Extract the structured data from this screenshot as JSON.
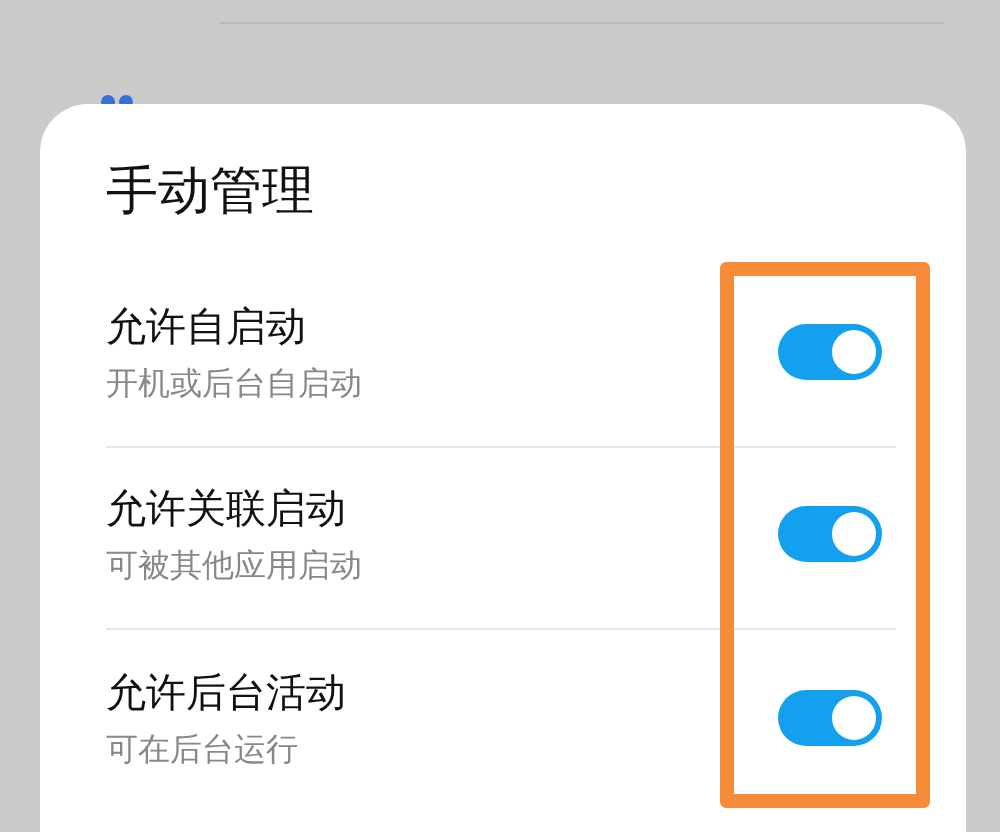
{
  "sheet": {
    "title": "手动管理",
    "options": [
      {
        "label": "允许自启动",
        "description": "开机或后台自启动",
        "on": true
      },
      {
        "label": "允许关联启动",
        "description": "可被其他应用启动",
        "on": true
      },
      {
        "label": "允许后台活动",
        "description": "可在后台运行",
        "on": true
      }
    ]
  }
}
